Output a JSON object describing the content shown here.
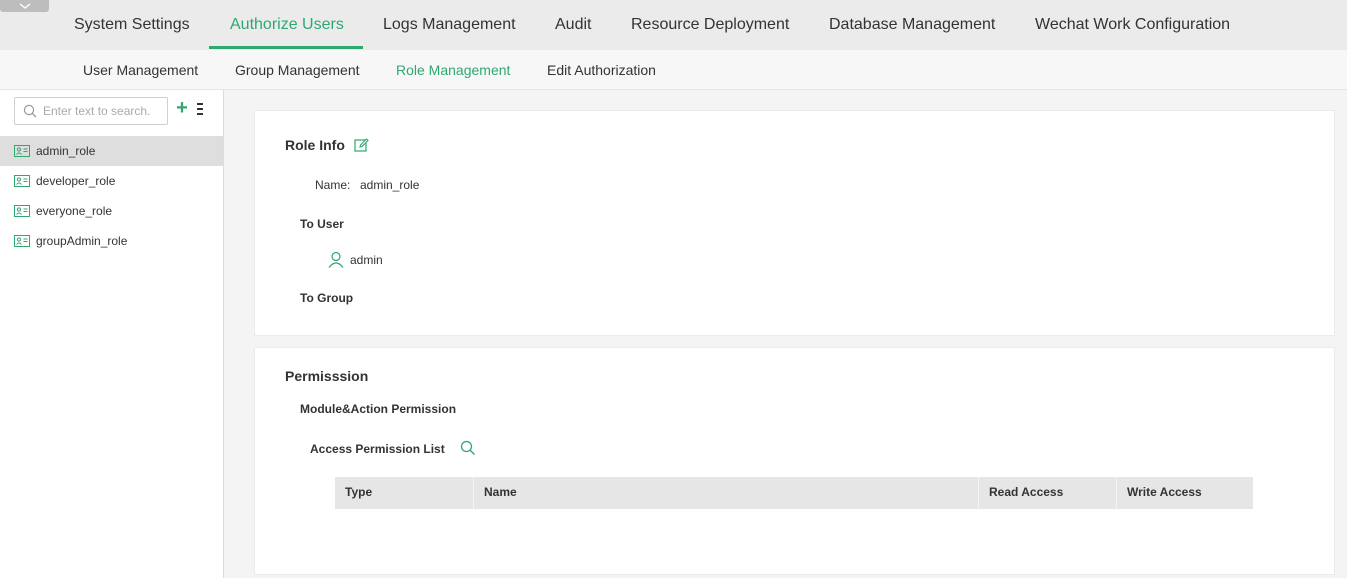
{
  "top_nav": {
    "items": [
      {
        "label": "System Settings"
      },
      {
        "label": "Authorize Users"
      },
      {
        "label": "Logs Management"
      },
      {
        "label": "Audit"
      },
      {
        "label": "Resource Deployment"
      },
      {
        "label": "Database Management"
      },
      {
        "label": "Wechat Work Configuration"
      }
    ],
    "active": "Authorize Users"
  },
  "sub_nav": {
    "items": [
      {
        "label": "User Management"
      },
      {
        "label": "Group Management"
      },
      {
        "label": "Role Management"
      },
      {
        "label": "Edit Authorization"
      }
    ],
    "active": "Role Management"
  },
  "sidebar": {
    "search_placeholder": "Enter text to search.",
    "add_label": "+",
    "roles": [
      {
        "label": "admin_role",
        "selected": true
      },
      {
        "label": "developer_role"
      },
      {
        "label": "everyone_role"
      },
      {
        "label": "groupAdmin_role"
      }
    ]
  },
  "role_info": {
    "title": "Role Info",
    "name_label": "Name:",
    "name_value": "admin_role",
    "to_user_label": "To User",
    "users": [
      {
        "label": "admin"
      }
    ],
    "to_group_label": "To Group"
  },
  "permission": {
    "title": "Permisssion",
    "module_action_label": "Module&Action Permission",
    "access_list_label": "Access Permission List",
    "columns": [
      "Type",
      "Name",
      "Read Access",
      "Write Access"
    ]
  },
  "colors": {
    "accent": "#2fa870",
    "topnav_bg": "#ebebeb",
    "selected_row": "#dedede",
    "table_header_bg": "#e6e6e6"
  }
}
